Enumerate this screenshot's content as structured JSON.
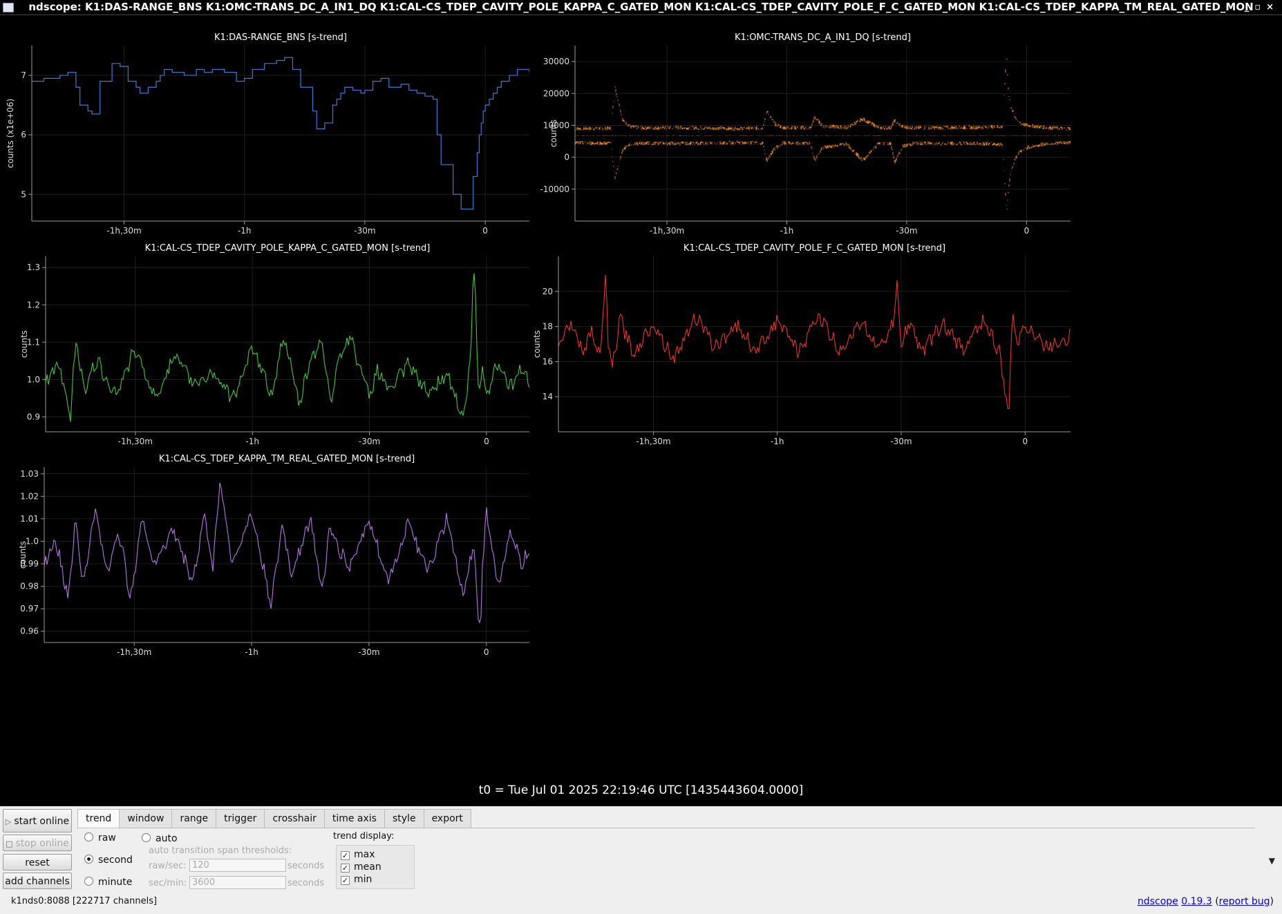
{
  "window": {
    "title": "ndscope: K1:DAS-RANGE_BNS K1:OMC-TRANS_DC_A_IN1_DQ K1:CAL-CS_TDEP_CAVITY_POLE_KAPPA_C_GATED_MON K1:CAL-CS_TDEP_CAVITY_POLE_F_C_GATED_MON K1:CAL-CS_TDEP_KAPPA_TM_REAL_GATED_MON",
    "controls": [
      "_",
      "▫",
      "×"
    ]
  },
  "t0_label": "t0 = Tue Jul 01 2025 22:19:46 UTC [1435443604.0000]",
  "xaxis_ticks": [
    {
      "label": "-1h,30m",
      "t": -90
    },
    {
      "label": "-1h",
      "t": -60
    },
    {
      "label": "-30m",
      "t": -30
    },
    {
      "label": "0",
      "t": 0
    }
  ],
  "chart_data": [
    {
      "type": "line",
      "title": "K1:DAS-RANGE_BNS [s-trend]",
      "ylabel": "counts (x1e+06)",
      "color": "#3a7bd5",
      "style": "step",
      "grid": true,
      "xlim": [
        -113,
        11
      ],
      "ylim": [
        4.55,
        7.5
      ],
      "yticks": [
        {
          "label": "5",
          "v": 5
        },
        {
          "label": "6",
          "v": 6
        },
        {
          "label": "7",
          "v": 7
        }
      ],
      "series": [
        {
          "x": [
            -113,
            -110,
            -106,
            -104,
            -102,
            -101,
            -99,
            -98,
            -96,
            -93,
            -91,
            -89,
            -87,
            -86,
            -85,
            -84,
            -82,
            -81,
            -80,
            -78,
            -75,
            -72,
            -70,
            -68,
            -65,
            -62,
            -60,
            -58,
            -55,
            -52,
            -50,
            -48,
            -46,
            -43,
            -42,
            -40,
            -38,
            -37,
            -36,
            -35,
            -33,
            -31,
            -30,
            -28,
            -26,
            -24,
            -21,
            -19,
            -17,
            -15,
            -13,
            -12,
            -11,
            -8,
            -6,
            -4,
            -3,
            -2,
            -1.5,
            -1,
            -0.5,
            0,
            1,
            2,
            3,
            4,
            6,
            8,
            10,
            11
          ],
          "y": [
            6.9,
            6.95,
            7.0,
            7.05,
            6.8,
            6.5,
            6.4,
            6.35,
            6.9,
            7.2,
            7.15,
            6.9,
            6.8,
            6.7,
            6.7,
            6.8,
            6.9,
            7.0,
            7.1,
            7.05,
            7.0,
            7.1,
            7.05,
            7.1,
            7.05,
            6.9,
            6.95,
            7.1,
            7.2,
            7.25,
            7.3,
            7.1,
            6.8,
            6.4,
            6.1,
            6.2,
            6.5,
            6.6,
            6.7,
            6.8,
            6.75,
            6.7,
            6.75,
            6.9,
            6.95,
            6.8,
            6.85,
            6.75,
            6.7,
            6.65,
            6.6,
            6.0,
            5.5,
            5.0,
            4.75,
            4.75,
            5.3,
            5.7,
            6.0,
            6.2,
            6.4,
            6.5,
            6.6,
            6.7,
            6.8,
            6.9,
            7.0,
            7.1,
            7.1,
            7.05
          ]
        }
      ]
    },
    {
      "type": "line",
      "title": "K1:OMC-TRANS_DC_A_IN1_DQ [s-trend]",
      "ylabel": "counts",
      "color": "#f28a25",
      "style": "dots",
      "grid": true,
      "xlim": [
        -113,
        11
      ],
      "ylim": [
        -20000,
        35000
      ],
      "yticks": [
        {
          "label": "-10000",
          "v": -10000
        },
        {
          "label": "0",
          "v": 0
        },
        {
          "label": "10000",
          "v": 10000
        },
        {
          "label": "20000",
          "v": 20000
        },
        {
          "label": "30000",
          "v": 30000
        }
      ],
      "series": [
        {
          "name": "max",
          "x": [
            -113,
            -104,
            -103,
            -101,
            -99,
            -96,
            -85,
            -73,
            -66,
            -65,
            -63,
            -61,
            -54,
            -53,
            -51,
            -45,
            -41,
            -37,
            -34,
            -33,
            -31,
            -28,
            -20,
            -10,
            -6,
            -5,
            -4.5,
            -4,
            -3,
            -2,
            0,
            5,
            11
          ],
          "y": [
            9000,
            9100,
            22000,
            11500,
            9500,
            9200,
            9300,
            9000,
            9200,
            14500,
            10500,
            9300,
            9200,
            12500,
            9800,
            9300,
            12000,
            9300,
            9200,
            11500,
            9500,
            9200,
            9300,
            9400,
            9600,
            33000,
            20000,
            16000,
            13000,
            11000,
            10000,
            9300,
            9000
          ]
        },
        {
          "name": "mean",
          "x": [
            -113,
            -60,
            0,
            11
          ],
          "y": [
            6800,
            6800,
            6800,
            6800
          ]
        },
        {
          "name": "min",
          "x": [
            -113,
            -104,
            -103,
            -101,
            -99,
            -96,
            -85,
            -73,
            -66,
            -65,
            -63,
            -61,
            -54,
            -53,
            -51,
            -45,
            -41,
            -37,
            -34,
            -33,
            -31,
            -28,
            -20,
            -10,
            -6,
            -5,
            -4.5,
            -4,
            -3,
            -2,
            0,
            5,
            11
          ],
          "y": [
            4500,
            4400,
            -6500,
            2500,
            4200,
            4400,
            4300,
            4600,
            4400,
            -1000,
            2800,
            4400,
            4300,
            -900,
            3000,
            4300,
            -1000,
            4300,
            4400,
            -1500,
            3400,
            4400,
            4300,
            4300,
            4000,
            -17000,
            -10000,
            -5000,
            -1000,
            1500,
            3000,
            4300,
            4600
          ]
        }
      ]
    },
    {
      "type": "line",
      "title": "K1:CAL-CS_TDEP_CAVITY_POLE_KAPPA_C_GATED_MON [s-trend]",
      "ylabel": "counts",
      "color": "#45c442",
      "style": "wiggle",
      "grid": true,
      "xlim": [
        -113,
        11
      ],
      "ylim": [
        0.86,
        1.33
      ],
      "yticks": [
        {
          "label": "0.9",
          "v": 0.9
        },
        {
          "label": "1.0",
          "v": 1.0
        },
        {
          "label": "1.1",
          "v": 1.1
        },
        {
          "label": "1.2",
          "v": 1.2
        },
        {
          "label": "1.3",
          "v": 1.3
        }
      ],
      "series": [
        {
          "x": [
            -113,
            -110,
            -108,
            -107,
            -106.5,
            -106,
            -105,
            -103,
            -100,
            -95,
            -90,
            -85,
            -80,
            -75,
            -70,
            -65,
            -60,
            -55,
            -52,
            -48,
            -45,
            -42,
            -40,
            -38,
            -35,
            -30,
            -28,
            -25,
            -20,
            -15,
            -10,
            -6,
            -4,
            -3.5,
            -3,
            -2.5,
            -2,
            -1,
            0,
            3,
            6,
            9,
            11
          ],
          "y": [
            1.0,
            1.04,
            0.97,
            0.9,
            0.9,
            1.03,
            1.1,
            0.97,
            1.05,
            0.96,
            1.08,
            0.95,
            1.06,
            0.99,
            1.02,
            0.95,
            1.08,
            0.96,
            1.12,
            0.93,
            1.06,
            1.1,
            0.94,
            1.05,
            1.12,
            0.95,
            1.03,
            0.97,
            1.04,
            0.96,
            1.02,
            0.89,
            1.06,
            1.25,
            1.3,
            1.1,
            0.95,
            1.04,
            0.96,
            1.05,
            0.98,
            1.03,
            1.0
          ]
        }
      ]
    },
    {
      "type": "line",
      "title": "K1:CAL-CS_TDEP_CAVITY_POLE_F_C_GATED_MON [s-trend]",
      "ylabel": "counts",
      "color": "#e8332e",
      "style": "wiggle",
      "grid": true,
      "xlim": [
        -113,
        11
      ],
      "ylim": [
        12,
        22
      ],
      "yticks": [
        {
          "label": "14",
          "v": 14
        },
        {
          "label": "16",
          "v": 16
        },
        {
          "label": "18",
          "v": 18
        },
        {
          "label": "20",
          "v": 20
        }
      ],
      "series": [
        {
          "x": [
            -113,
            -110,
            -107,
            -105,
            -103,
            -102,
            -101.5,
            -101,
            -100,
            -98,
            -95,
            -90,
            -85,
            -80,
            -75,
            -70,
            -65,
            -60,
            -55,
            -50,
            -45,
            -40,
            -35,
            -32,
            -31,
            -30,
            -28,
            -25,
            -20,
            -15,
            -10,
            -6,
            -4.5,
            -4,
            -3.5,
            -3,
            -2,
            0,
            5,
            11
          ],
          "y": [
            17,
            18.2,
            16.5,
            17.8,
            16.2,
            19,
            21.5,
            17,
            15.6,
            18.5,
            16.4,
            18.2,
            16.1,
            18.6,
            16.8,
            18.1,
            16.6,
            18.4,
            16.5,
            18.7,
            16.6,
            18.2,
            16.7,
            18.3,
            20.2,
            16.9,
            18.3,
            16.6,
            18.1,
            16.7,
            18.4,
            16.3,
            13.5,
            12.6,
            16.5,
            19,
            17,
            18.2,
            16.8,
            17.5
          ]
        }
      ]
    },
    {
      "type": "line",
      "title": "K1:CAL-CS_TDEP_KAPPA_TM_REAL_GATED_MON [s-trend]",
      "ylabel": "counts",
      "color": "#b277e0",
      "style": "wiggle",
      "grid": true,
      "xlim": [
        -113,
        11
      ],
      "ylim": [
        0.955,
        1.033
      ],
      "yticks": [
        {
          "label": "0.96",
          "v": 0.96
        },
        {
          "label": "0.97",
          "v": 0.97
        },
        {
          "label": "0.98",
          "v": 0.98
        },
        {
          "label": "0.99",
          "v": 0.99
        },
        {
          "label": "1.0",
          "v": 1.0
        },
        {
          "label": "1.01",
          "v": 1.01
        },
        {
          "label": "1.02",
          "v": 1.02
        },
        {
          "label": "1.03",
          "v": 1.03
        }
      ],
      "series": [
        {
          "x": [
            -113,
            -110,
            -107,
            -105,
            -103,
            -100,
            -97,
            -94,
            -91,
            -88,
            -85,
            -80,
            -75,
            -72,
            -70,
            -68,
            -65,
            -60,
            -55,
            -52,
            -50,
            -45,
            -42,
            -40,
            -35,
            -30,
            -25,
            -20,
            -15,
            -10,
            -6,
            -3,
            -2,
            -1.5,
            -1,
            0,
            3,
            6,
            9,
            11
          ],
          "y": [
            0.99,
            1.0,
            0.975,
            1.01,
            0.98,
            1.015,
            0.985,
            1.005,
            0.975,
            1.01,
            0.99,
            1.005,
            0.982,
            1.012,
            0.988,
            1.027,
            0.99,
            1.012,
            0.972,
            1.008,
            0.985,
            1.01,
            0.978,
            1.005,
            0.988,
            1.01,
            0.982,
            1.008,
            0.986,
            1.01,
            0.975,
            1.0,
            0.962,
            0.96,
            0.99,
            1.013,
            0.98,
            1.003,
            0.99,
            0.995
          ]
        }
      ]
    }
  ],
  "controls": {
    "buttons": {
      "start_online": "start online",
      "stop_online": "stop online",
      "reset": "reset",
      "add_channels": "add channels"
    },
    "tabs": [
      "trend",
      "window",
      "range",
      "trigger",
      "crosshair",
      "time axis",
      "style",
      "export"
    ],
    "active_tab": "trend",
    "trend": {
      "raw_label": "raw",
      "auto_label": "auto",
      "second_label": "second",
      "minute_label": "minute",
      "selected": "second",
      "thresholds_label": "auto transition span thresholds:",
      "raw_sec_label": "raw/sec:",
      "raw_sec_value": "120",
      "sec_min_label": "sec/min:",
      "sec_min_value": "3600",
      "seconds_label": "seconds",
      "trend_display_label": "trend display:",
      "display": [
        {
          "label": "max",
          "checked": true
        },
        {
          "label": "mean",
          "checked": true
        },
        {
          "label": "min",
          "checked": true
        }
      ]
    }
  },
  "status": {
    "server": "k1nds0:8088  [222717 channels]",
    "app_name": "ndscope",
    "version": "0.19.3",
    "report_bug": "report bug"
  }
}
